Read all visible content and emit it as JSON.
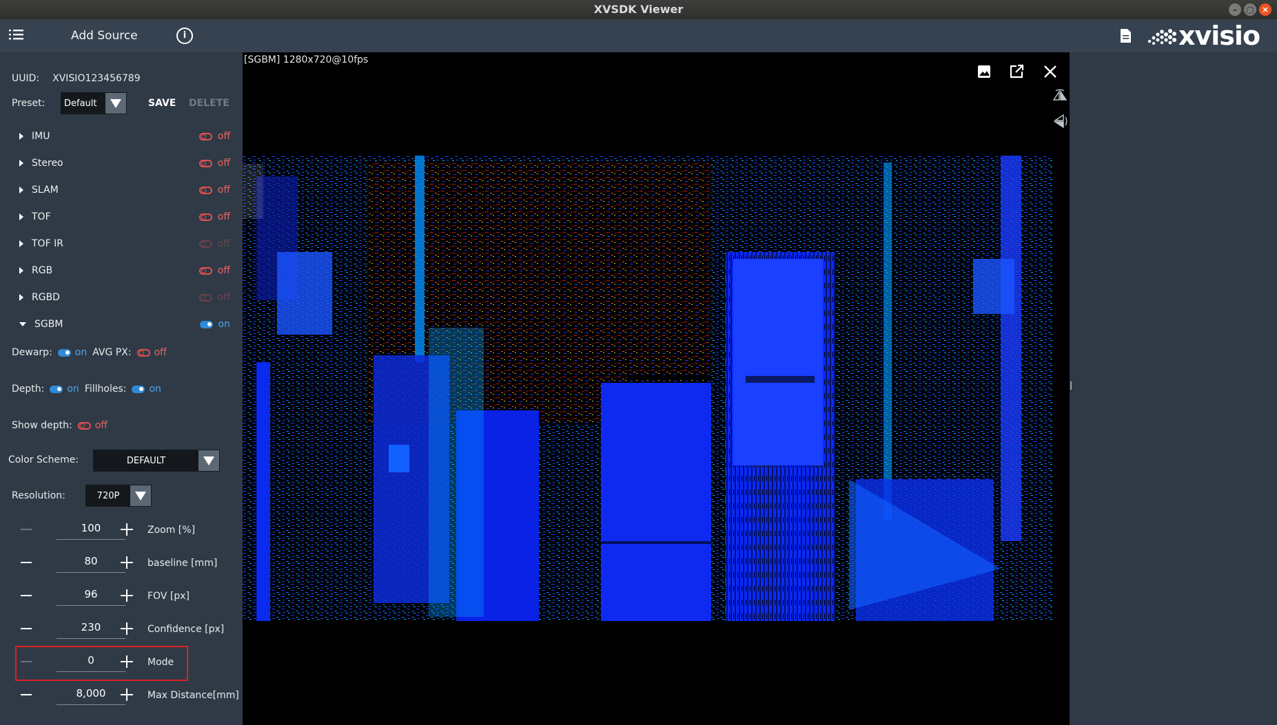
{
  "window": {
    "title": "XVSDK Viewer",
    "controls": [
      "–",
      "▢",
      "×"
    ]
  },
  "appbar": {
    "menu_icon": "list-icon",
    "add_source": "Add Source",
    "info_icon": "info-icon",
    "doc_icon": "document-icon",
    "logo_text": "xvisio"
  },
  "sidebar": {
    "uuid_label": "UUID:",
    "uuid_value": "XVISIO123456789",
    "preset_label": "Preset:",
    "preset_value": "Default",
    "save": "SAVE",
    "delete": "DELETE",
    "sections": [
      {
        "name": "IMU",
        "state": "off",
        "expanded": false,
        "enabled": true
      },
      {
        "name": "Stereo",
        "state": "off",
        "expanded": false,
        "enabled": true
      },
      {
        "name": "SLAM",
        "state": "off",
        "expanded": false,
        "enabled": true
      },
      {
        "name": "TOF",
        "state": "off",
        "expanded": false,
        "enabled": true
      },
      {
        "name": "TOF IR",
        "state": "off",
        "expanded": false,
        "enabled": false
      },
      {
        "name": "RGB",
        "state": "off",
        "expanded": false,
        "enabled": true
      },
      {
        "name": "RGBD",
        "state": "off",
        "expanded": false,
        "enabled": false
      },
      {
        "name": "SGBM",
        "state": "on",
        "expanded": true,
        "enabled": true
      }
    ],
    "dewarp_label": "Dewarp:",
    "dewarp_state": "on",
    "avgpx_label": "AVG PX:",
    "avgpx_state": "off",
    "depth_label": "Depth:",
    "depth_state": "on",
    "fillholes_label": "Fillholes:",
    "fillholes_state": "on",
    "showdepth_label": "Show depth:",
    "showdepth_state": "off",
    "color_scheme_label": "Color Scheme:",
    "color_scheme_value": "DEFAULT",
    "resolution_label": "Resolution:",
    "resolution_value": "720P",
    "steppers": [
      {
        "value": "100",
        "label": "Zoom [%]",
        "minus_enabled": false
      },
      {
        "value": "80",
        "label": "baseline [mm]",
        "minus_enabled": true
      },
      {
        "value": "96",
        "label": "FOV [px]",
        "minus_enabled": true
      },
      {
        "value": "230",
        "label": "Confidence [px]",
        "minus_enabled": true
      },
      {
        "value": "0",
        "label": "Mode",
        "minus_enabled": false
      },
      {
        "value": "8,000",
        "label": "Max Distance[mm]",
        "minus_enabled": true
      }
    ]
  },
  "viewer": {
    "stream_title": "[SGBM]  1280x720@10fps",
    "icons": [
      "image-icon",
      "open-external-icon",
      "close-icon",
      "flip-horizontal-icon",
      "flip-vertical-icon"
    ]
  },
  "colors": {
    "panel": "#2f3a46",
    "appbar": "#364250",
    "toggle_on": "#2f8ad8",
    "toggle_off": "#e05050",
    "highlight": "#e02020"
  }
}
